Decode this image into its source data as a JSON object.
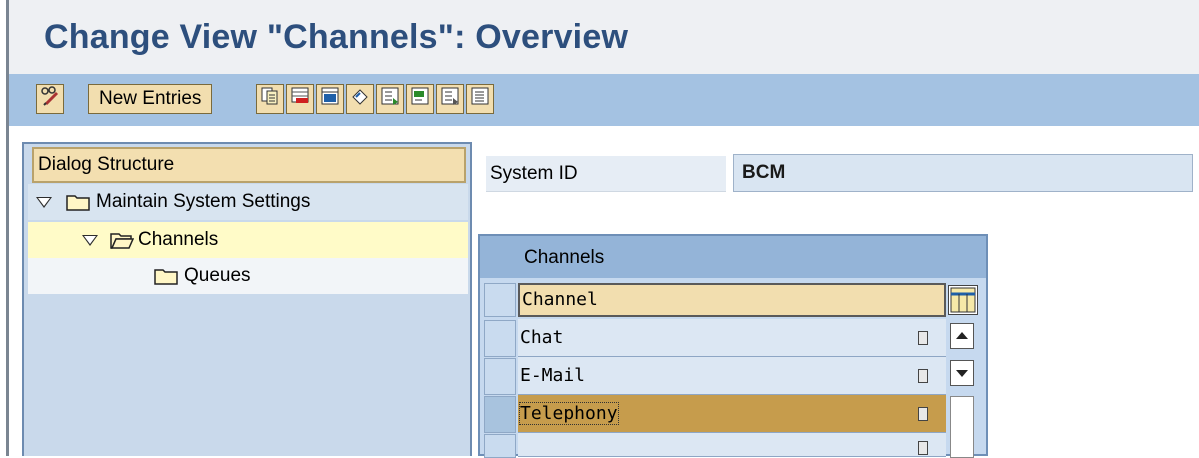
{
  "window": {
    "title": "Change View \"Channels\": Overview"
  },
  "toolbar": {
    "new_entries_label": "New Entries"
  },
  "dialog_structure": {
    "header": "Dialog Structure",
    "items": [
      {
        "label": "Maintain System Settings",
        "expanded": true,
        "level": 0
      },
      {
        "label": "Channels",
        "expanded": true,
        "level": 1,
        "selected": true
      },
      {
        "label": "Queues",
        "expanded": false,
        "level": 2
      }
    ]
  },
  "fields": {
    "system_id_label": "System ID",
    "system_id_value": "BCM"
  },
  "table": {
    "title": "Channels",
    "column_header": "Channel",
    "rows": [
      "Chat",
      "E-Mail",
      "Telephony",
      ""
    ],
    "selected_row": 2
  },
  "colors": {
    "title": "#2d4f7d",
    "toolbar": "#a4c2e2",
    "selection": "#c69c4c",
    "header_bg": "#f2deaf"
  }
}
